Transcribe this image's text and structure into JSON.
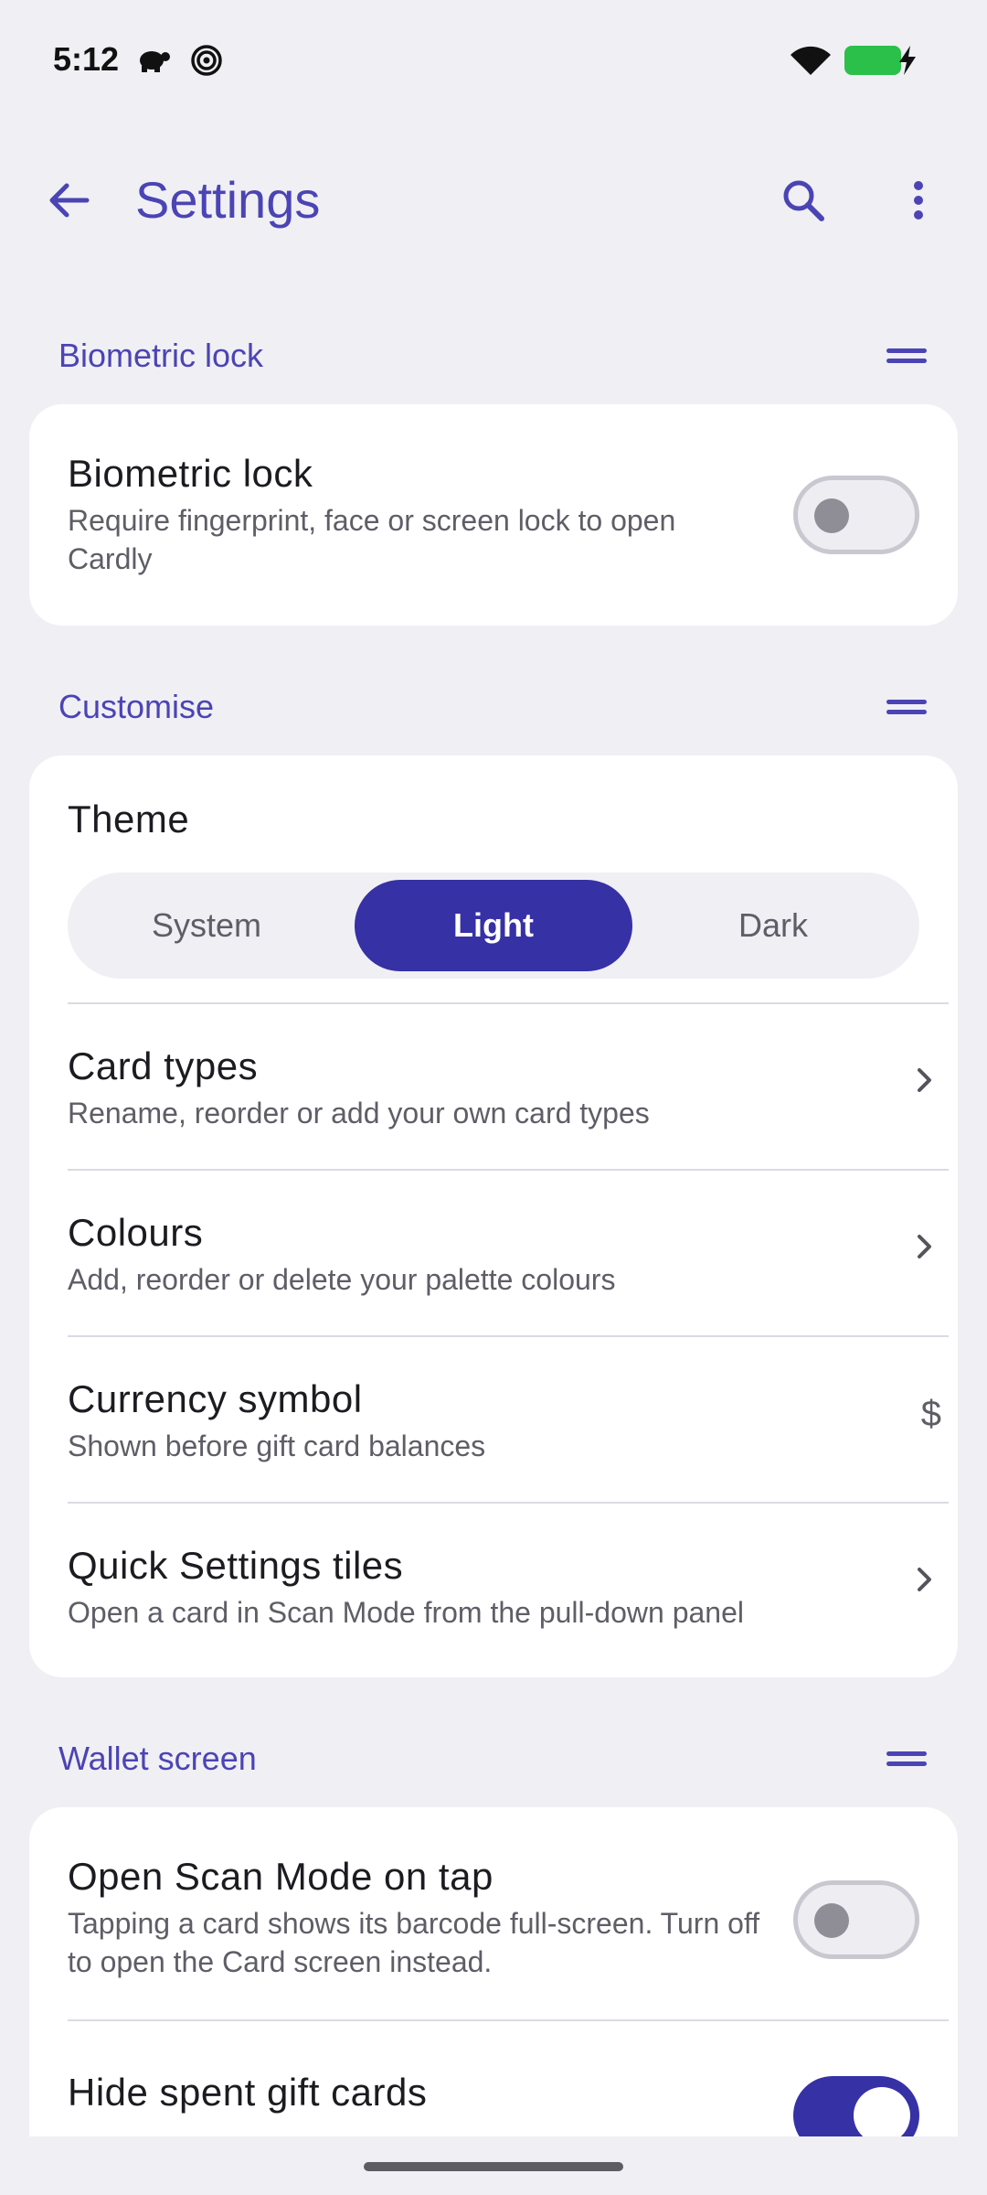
{
  "status_bar": {
    "time": "5:12",
    "icons": [
      "turtle-icon",
      "spiral-icon",
      "wifi-icon",
      "battery-icon",
      "charging-bolt-icon"
    ]
  },
  "app_bar": {
    "title": "Settings",
    "back_icon": "arrow-left-icon",
    "search_icon": "search-icon",
    "more_icon": "more-vert-icon"
  },
  "sections": {
    "biometric": {
      "header": "Biometric lock",
      "item": {
        "title": "Biometric lock",
        "subtitle": "Require fingerprint, face or screen lock to open Cardly",
        "enabled": false
      }
    },
    "customise": {
      "header": "Customise",
      "theme": {
        "title": "Theme",
        "options": [
          "System",
          "Light",
          "Dark"
        ],
        "selected": "Light"
      },
      "card_types": {
        "title": "Card types",
        "subtitle": "Rename, reorder or add your own card types"
      },
      "colours": {
        "title": "Colours",
        "subtitle": "Add, reorder or delete your palette colours"
      },
      "currency": {
        "title": "Currency symbol",
        "subtitle": "Shown before gift card balances",
        "value": "$"
      },
      "quick_settings": {
        "title": "Quick Settings tiles",
        "subtitle": "Open a card in Scan Mode from the pull-down panel"
      }
    },
    "wallet": {
      "header": "Wallet screen",
      "open_scan": {
        "title": "Open Scan Mode on tap",
        "subtitle": "Tapping a card shows its barcode full-screen. Turn off to open the Card screen instead.",
        "enabled": false
      },
      "hide_spent": {
        "title": "Hide spent gift cards",
        "enabled": true
      }
    }
  },
  "colors": {
    "accent": "#4B44B4",
    "selected": "#3631A5",
    "background": "#F0EFF4"
  }
}
